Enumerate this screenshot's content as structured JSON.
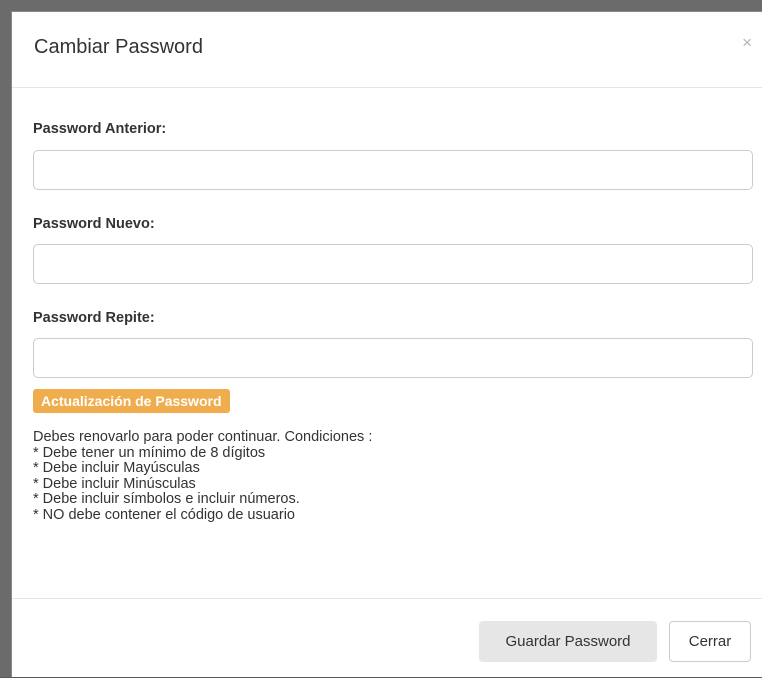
{
  "dialog": {
    "title": "Cambiar Password",
    "close_symbol": "×"
  },
  "form": {
    "old_password": {
      "label": "Password Anterior:",
      "value": "",
      "placeholder": ""
    },
    "new_password": {
      "label": "Password Nuevo:",
      "value": "",
      "placeholder": ""
    },
    "repeat_password": {
      "label": "Password Repite:",
      "value": "",
      "placeholder": ""
    }
  },
  "notice": {
    "badge": "Actualización de Password",
    "badge_color": "#f0ad4e",
    "lines": [
      "Debes renovarlo para poder continuar. Condiciones :",
      "* Debe tener un mínimo de 8 dígitos",
      "* Debe incluir Mayúsculas",
      "* Debe incluir Minúsculas",
      "* Debe incluir símbolos e incluir números.",
      "* NO debe contener el código de usuario"
    ]
  },
  "footer": {
    "save_label": "Guardar Password",
    "close_label": "Cerrar"
  }
}
